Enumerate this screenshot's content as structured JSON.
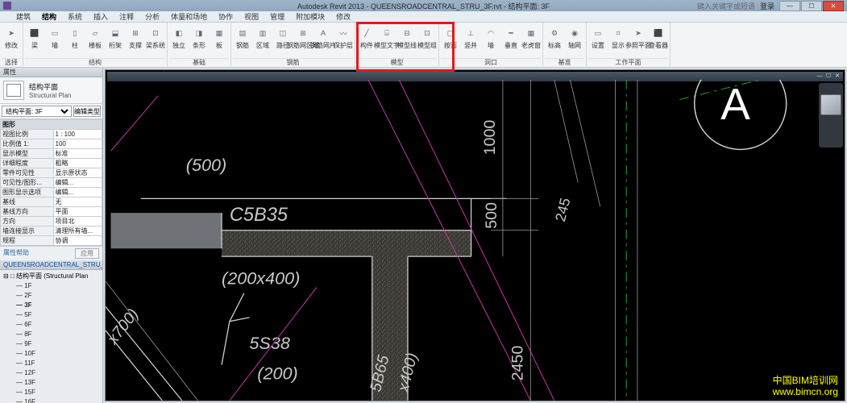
{
  "app": {
    "title_left": "Autodesk Revit 2013 -",
    "title_doc": "QUEENSROADCENTRAL_STRU_3F.rvt - 结构平面: 3F",
    "search_ph": "键入关键字或短语",
    "user": "登录"
  },
  "menu": [
    "建筑",
    "结构",
    "系统",
    "插入",
    "注释",
    "分析",
    "体量和场地",
    "协作",
    "视图",
    "管理",
    "附加模块",
    "修改"
  ],
  "menu_active_index": 1,
  "ribbon": {
    "groups": [
      {
        "title": "选择",
        "items": [
          {
            "l": "修改"
          }
        ]
      },
      {
        "title": "结构",
        "items": [
          {
            "l": "梁"
          },
          {
            "l": "墙"
          },
          {
            "l": "柱"
          },
          {
            "l": "楼板"
          },
          {
            "l": "桁架"
          },
          {
            "l": "支撑"
          },
          {
            "l": "梁系统"
          }
        ]
      },
      {
        "title": "基础",
        "items": [
          {
            "l": "独立"
          },
          {
            "l": "条形"
          },
          {
            "l": "板"
          }
        ]
      },
      {
        "title": "钢筋",
        "items": [
          {
            "l": "钢筋"
          },
          {
            "l": "区域"
          },
          {
            "l": "路径"
          },
          {
            "l": "钢筋网区域"
          },
          {
            "l": "钢筋网片"
          },
          {
            "l": "保护层"
          }
        ]
      },
      {
        "title": "模型",
        "items": [
          {
            "l": "构件"
          },
          {
            "l": "模型文字"
          },
          {
            "l": "模型线"
          },
          {
            "l": "模型组"
          }
        ]
      },
      {
        "title": "洞口",
        "items": [
          {
            "l": "按面"
          },
          {
            "l": "竖井"
          },
          {
            "l": "墙"
          },
          {
            "l": "垂直"
          },
          {
            "l": "老虎窗"
          }
        ]
      },
      {
        "title": "基准",
        "items": [
          {
            "l": "标高"
          },
          {
            "l": "轴网"
          }
        ]
      },
      {
        "title": "工作平面",
        "items": [
          {
            "l": "设置"
          },
          {
            "l": "显示"
          },
          {
            "l": "参照平面"
          },
          {
            "l": "查看器"
          }
        ]
      }
    ]
  },
  "props": {
    "panel": "属性",
    "type_main": "结构平面",
    "type_sub": "Structural Plan",
    "selector": "结构平面: 3F",
    "edit_type": "编辑类型",
    "rows": [
      [
        "视图比例",
        "1 : 100"
      ],
      [
        "比例值 1:",
        "100"
      ],
      [
        "显示模型",
        "标准"
      ],
      [
        "详细程度",
        "粗略"
      ],
      [
        "零件可见性",
        "显示原状态"
      ],
      [
        "可见性/图形...",
        "编辑..."
      ],
      [
        "图形显示选项",
        "编辑..."
      ],
      [
        "基线",
        "无"
      ],
      [
        "基线方向",
        "平面"
      ],
      [
        "方向",
        "项目北"
      ],
      [
        "墙连接显示",
        "清理所有墙..."
      ],
      [
        "规程",
        "协调"
      ]
    ],
    "help": "属性帮助",
    "apply": "应用",
    "section": "图形"
  },
  "browser": {
    "title": "QUEENSROADCENTRAL_STRU_3...",
    "root": "结构平面 (Structural Plan",
    "items": [
      "1F",
      "2F",
      "3F",
      "5F",
      "6F",
      "8F",
      "9F",
      "10F",
      "11F",
      "12F",
      "13F",
      "15F",
      "16F"
    ],
    "bold_index": 2
  },
  "view": {
    "title": ""
  },
  "drawing": {
    "dim500_paren": "(500)",
    "beam1": "C5B35",
    "size1": "(200x400)",
    "beam2": "5S38",
    "size2": "(200)",
    "beam3": "5B65",
    "size3": "x400)",
    "x700": "x700)",
    "dim1000": "1000",
    "dim500": "500",
    "dim2450": "2450",
    "dim245": "245",
    "grid": "A"
  },
  "watermark": {
    "l1": "中国BIM培训网",
    "l2": "www.bimcn.org"
  }
}
